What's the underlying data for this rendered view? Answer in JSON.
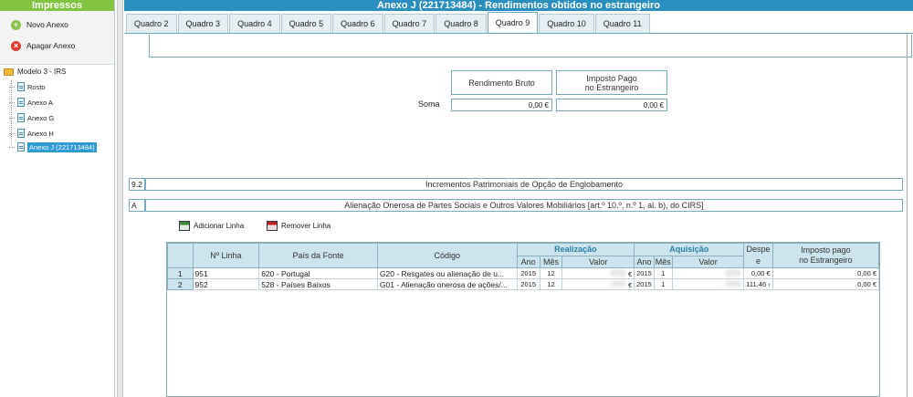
{
  "left_panel": {
    "header": "Impressos",
    "actions": {
      "new": "Novo Anexo",
      "delete": "Apagar Anexo"
    },
    "tree": {
      "root": "Modelo 3 - IRS",
      "items": [
        "Rosto",
        "Anexo A",
        "Anexo G",
        "Anexo H",
        "Anexo J (221713484)"
      ],
      "selected_index": 4
    }
  },
  "main": {
    "title": "Anexo J (221713484) - Rendimentos obtidos no estrangeiro",
    "tabs": [
      "Quadro 2",
      "Quadro 3",
      "Quadro 4",
      "Quadro 5",
      "Quadro 6",
      "Quadro 7",
      "Quadro 8",
      "Quadro 9",
      "Quadro 10",
      "Quadro 11"
    ],
    "active_tab": "Quadro 9",
    "summary": {
      "col1_header": "Rendimento Bruto",
      "col2_header_line1": "Imposto Pago",
      "col2_header_line2": "no Estrangeiro",
      "soma_label": "Soma",
      "rendimento_bruto": "0,00 €",
      "imposto_pago": "0,00 €"
    },
    "section_92": {
      "num": "9.2",
      "title": "Incrementos Patrimoniais de Opção de Englobamento"
    },
    "section_a": {
      "num": "A",
      "title": "Alienação Onerosa de Partes Sociais e Outros Valores Mobiliários [art.º 10.º, n.º 1, al. b), do CIRS]"
    },
    "toolbar": {
      "add": "Adicionar Linha",
      "remove": "Remover Linha"
    },
    "grid": {
      "headers": {
        "nlinha": "Nº Linha",
        "pais": "País da Fonte",
        "codigo": "Código",
        "realizacao": "Realização",
        "aquisicao": "Aquisição",
        "despesas": "Despe\ne",
        "imposto_line1": "Imposto pago",
        "imposto_line2": "no Estrangeiro",
        "ano": "Ano",
        "mes": "Mês",
        "valor": "Valor"
      },
      "rows": [
        {
          "n": "1",
          "linha": "951",
          "pais": "620 - Portugal",
          "codigo": "G20 - Resgates ou alienação de u...",
          "r_ano": "2015",
          "r_mes": "12",
          "r_valor_suffix": "€",
          "a_ano": "2015",
          "a_mes": "1",
          "despesas": "0,00 €",
          "imposto": "0,00 €"
        },
        {
          "n": "2",
          "linha": "952",
          "pais": "528 - Países Baixos",
          "codigo": "G01 - Alienação onerosa de ações/...",
          "r_ano": "2015",
          "r_mes": "12",
          "r_valor_suffix": "€",
          "a_ano": "2015",
          "a_mes": "1",
          "despesas": "111,46 ‹",
          "imposto": "0,00 €"
        }
      ]
    }
  },
  "colors": {
    "title_bar": "#2a8fbf",
    "left_header": "#82c341",
    "selected": "#2d9ad4",
    "grid_header": "#cce4ed"
  }
}
